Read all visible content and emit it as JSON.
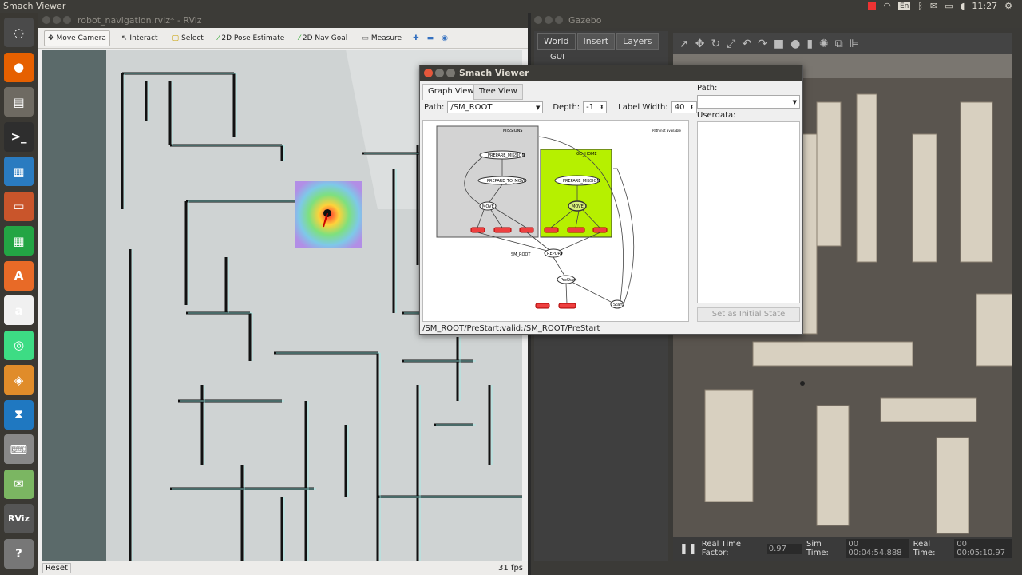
{
  "topbar": {
    "title": "Smach Viewer",
    "lang": "En",
    "time": "11:27"
  },
  "launcher": {
    "items": [
      {
        "name": "ubuntu-dash-icon",
        "glyph": "◌",
        "color": "#4a4a4a"
      },
      {
        "name": "firefox-icon",
        "glyph": "●",
        "color": "#e66000"
      },
      {
        "name": "files-icon",
        "glyph": "▤",
        "color": "#6e6a62"
      },
      {
        "name": "terminal-icon",
        "glyph": ">_",
        "color": "#2e2e2e"
      },
      {
        "name": "libreoffice-writer-icon",
        "glyph": "▦",
        "color": "#2a7bc0"
      },
      {
        "name": "libreoffice-impress-icon",
        "glyph": "▭",
        "color": "#c9552b"
      },
      {
        "name": "libreoffice-calc-icon",
        "glyph": "▦",
        "color": "#23a544"
      },
      {
        "name": "software-center-icon",
        "glyph": "A",
        "color": "#e86a27"
      },
      {
        "name": "amazon-icon",
        "glyph": "a",
        "color": "#f0f0f0"
      },
      {
        "name": "android-studio-icon",
        "glyph": "◎",
        "color": "#3ddc84"
      },
      {
        "name": "virtualbox-icon",
        "glyph": "◈",
        "color": "#e08c2a"
      },
      {
        "name": "vscode-icon",
        "glyph": "⧗",
        "color": "#1f78c1"
      },
      {
        "name": "keyboard-icon",
        "glyph": "⌨",
        "color": "#888"
      },
      {
        "name": "mail-icon",
        "glyph": "✉",
        "color": "#7bb662"
      },
      {
        "name": "rviz-icon",
        "glyph": "RViz",
        "color": "#555"
      },
      {
        "name": "help-icon",
        "glyph": "?",
        "color": "#777"
      }
    ]
  },
  "rviz": {
    "window_title": "robot_navigation.rviz* - RViz",
    "tools": [
      {
        "label": "Move Camera",
        "icon": "move-camera-icon"
      },
      {
        "label": "Interact",
        "icon": "interact-icon"
      },
      {
        "label": "Select",
        "icon": "select-icon"
      },
      {
        "label": "2D Pose Estimate",
        "icon": "pose-estimate-icon"
      },
      {
        "label": "2D Nav Goal",
        "icon": "nav-goal-icon"
      },
      {
        "label": "Measure",
        "icon": "measure-icon"
      }
    ],
    "reset_label": "Reset",
    "fps": "31 fps"
  },
  "gazebo": {
    "window_title": "Gazebo",
    "tabs": [
      "World",
      "Insert",
      "Layers"
    ],
    "tree_item": "GUI",
    "rtf_label": "Real Time Factor:",
    "rtf_value": "0.97",
    "sim_label": "Sim Time:",
    "sim_value": "00 00:04:54.888",
    "real_label": "Real Time:",
    "real_value": "00 00:05:10.97"
  },
  "smach": {
    "window_title": "Smach Viewer",
    "tabs": {
      "graph": "Graph View",
      "tree": "Tree View"
    },
    "path_label": "Path:",
    "path_value": "/SM_ROOT",
    "depth_label": "Depth:",
    "depth_value": "-1",
    "width_label": "Label Width:",
    "width_value": "40",
    "right_path_label": "Path:",
    "userdata_label": "Userdata:",
    "initial_state_label": "Set as Initial State",
    "status": "/SM_ROOT/PreStart:valid:/SM_ROOT/PreStart",
    "graph": {
      "missions": "MISSIONS",
      "prepare_mission": "PREPARE_MISSION",
      "prepare_to_move": "PREPARE_TO_MOVE",
      "move": "MOVE",
      "go_home": "GO_HOME",
      "sm_root": "SM_ROOT",
      "report": "REPORT",
      "prestart": "PreStart",
      "start": "Start",
      "note": "Path not available"
    }
  }
}
